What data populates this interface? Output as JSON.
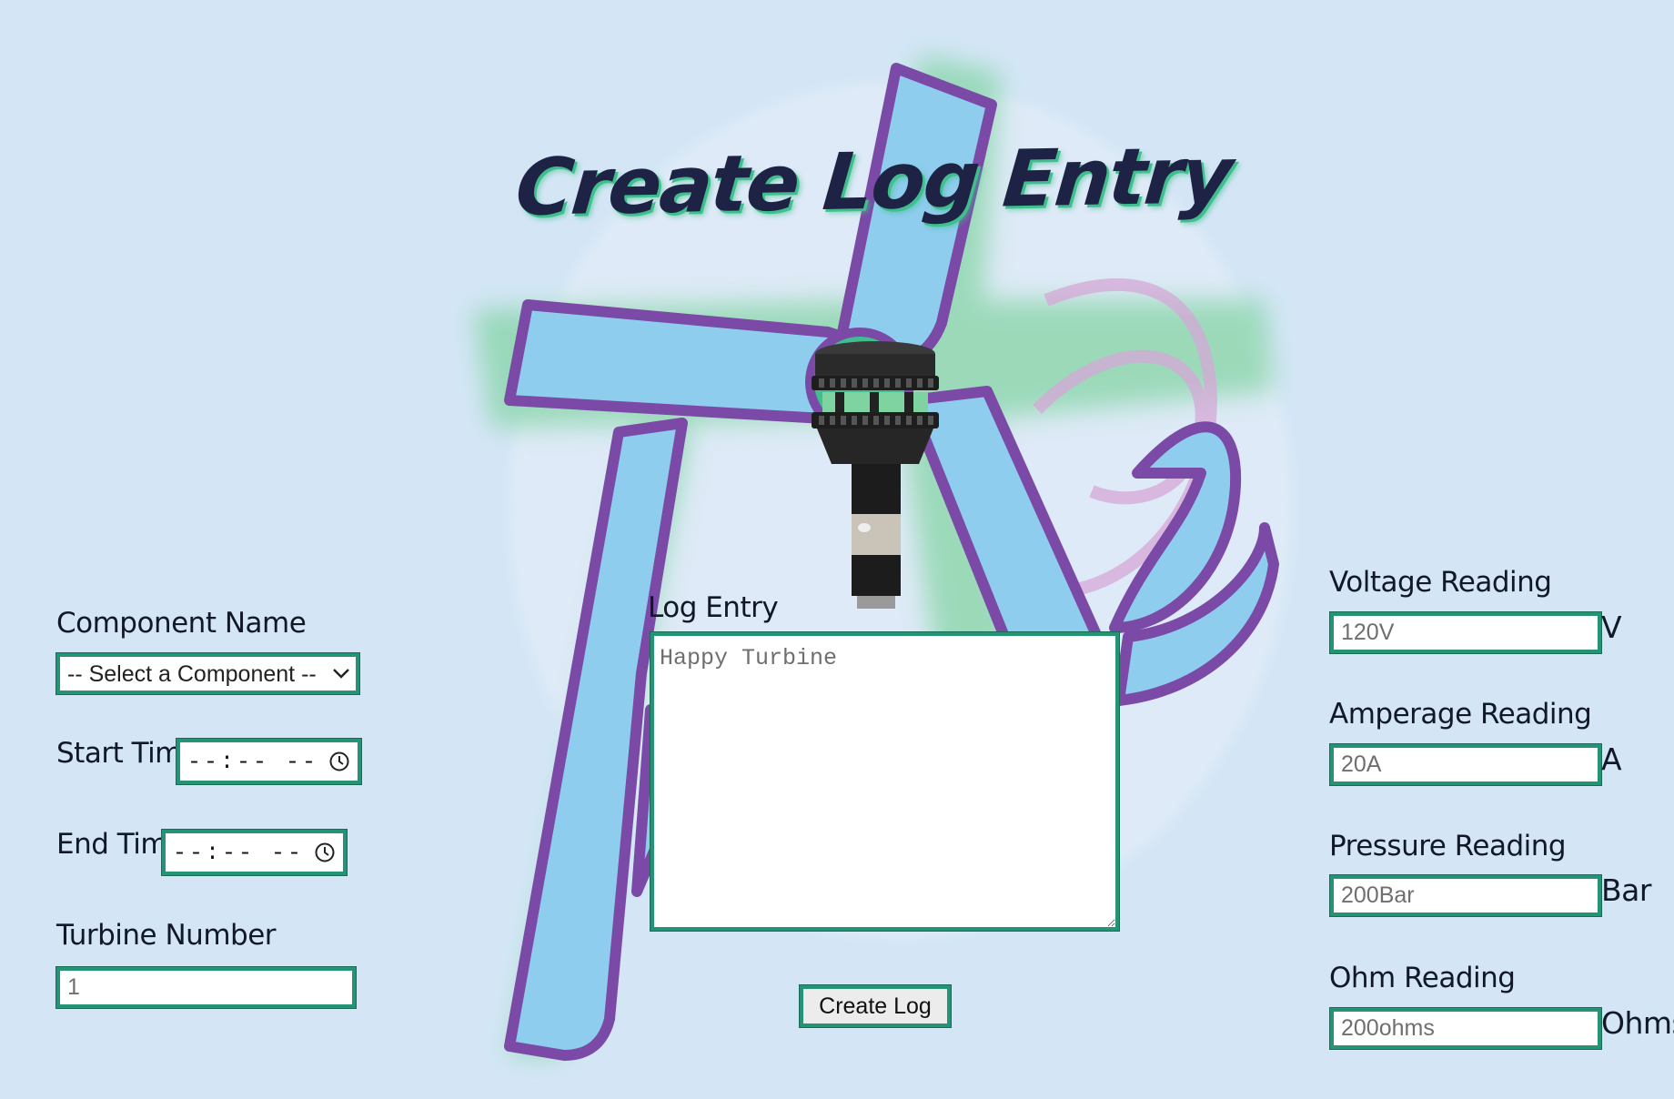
{
  "page": {
    "title": "Create Log Entry"
  },
  "left_form": {
    "component_name_label": "Component Name",
    "component_select_value": "-- Select a Component --",
    "start_time_label": "Start Time",
    "start_time_placeholder": "--:-- --",
    "end_time_label": "End Time",
    "end_time_placeholder": "--:-- --",
    "turbine_number_label": "Turbine Number",
    "turbine_number_placeholder": "1"
  },
  "center_form": {
    "log_entry_label": "Log Entry",
    "log_entry_placeholder": "Happy Turbine",
    "create_button_label": "Create Log"
  },
  "right_form": {
    "voltage_label": "Voltage Reading",
    "voltage_placeholder": "120V",
    "voltage_unit": "V",
    "amperage_label": "Amperage Reading",
    "amperage_placeholder": "20A",
    "amperage_unit": "A",
    "pressure_label": "Pressure Reading",
    "pressure_placeholder": "200Bar",
    "pressure_unit": "Bar",
    "ohm_label": "Ohm Reading",
    "ohm_placeholder": "200ohms",
    "ohm_unit": "Ohms"
  },
  "icons": {
    "select_arrow": "chevron-down-icon",
    "time_picker": "clock-icon",
    "logo": "turbine-logo-icon",
    "product": "wind-sensor-turbine-icon"
  },
  "colors": {
    "background": "#d4e6f6",
    "field_border": "#249474",
    "title": "#1e2346",
    "title_shadow": "#3fbf8e",
    "logo_fill": "#8fcdee",
    "logo_outline": "#7a4aa6",
    "logo_spray": "#7fd3a0"
  }
}
